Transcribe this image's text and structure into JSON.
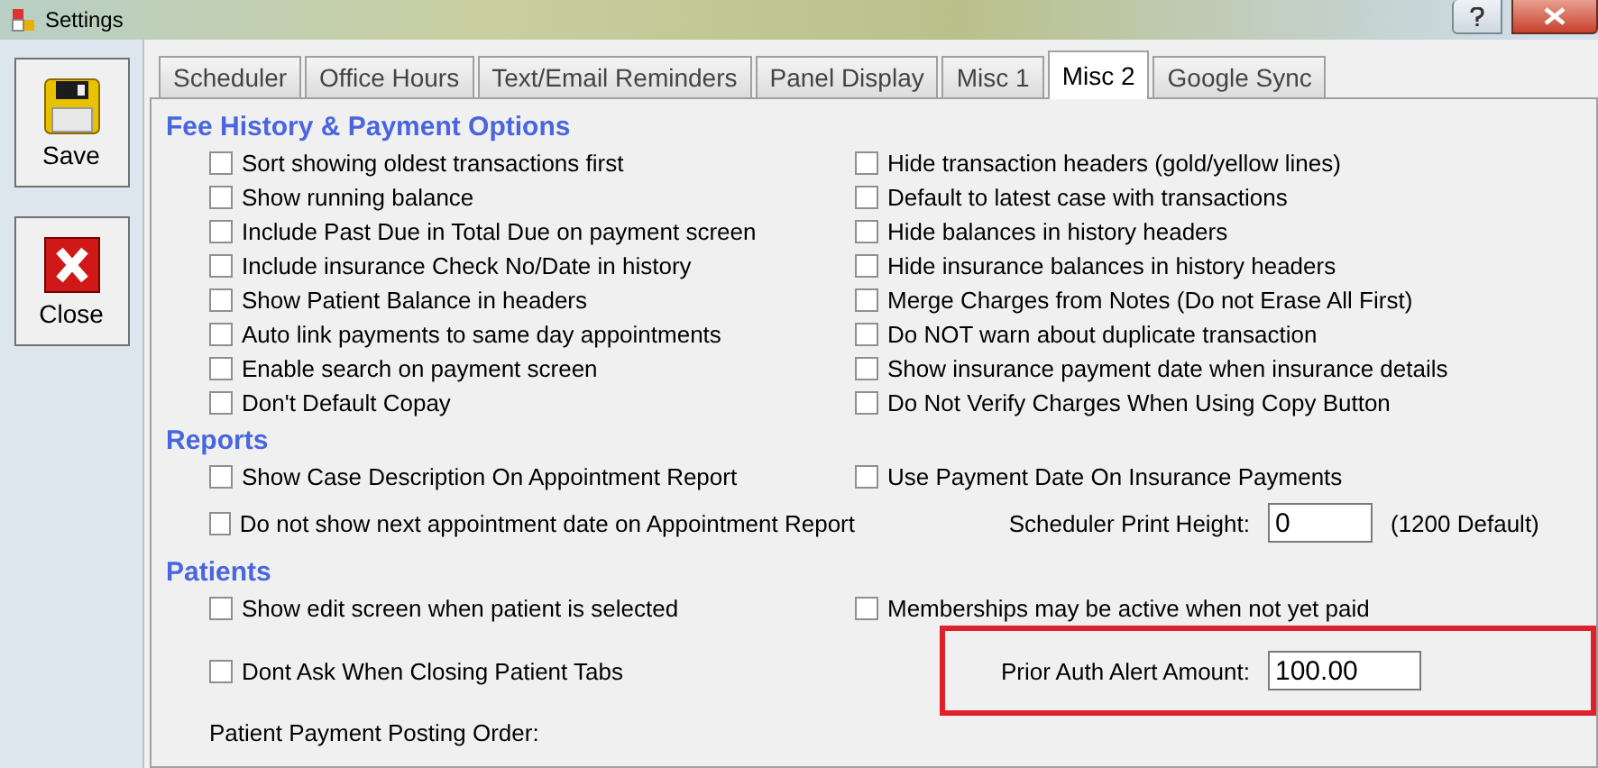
{
  "window": {
    "title": "Settings"
  },
  "sidebar": {
    "buttons": [
      {
        "label": "Save",
        "kind": "save"
      },
      {
        "label": "Close",
        "kind": "close"
      }
    ]
  },
  "tabs": [
    {
      "label": "Scheduler",
      "selected": false
    },
    {
      "label": "Office Hours",
      "selected": false
    },
    {
      "label": "Text/Email Reminders",
      "selected": false
    },
    {
      "label": "Panel Display",
      "selected": false
    },
    {
      "label": "Misc 1",
      "selected": false
    },
    {
      "label": "Misc 2",
      "selected": true
    },
    {
      "label": "Google Sync",
      "selected": false
    }
  ],
  "sections": [
    {
      "heading": "Fee History & Payment Options",
      "rows": [
        [
          {
            "kind": "checkbox",
            "label": "Sort showing oldest transactions first",
            "checked": false
          },
          {
            "kind": "checkbox",
            "label": "Hide transaction headers (gold/yellow lines)",
            "checked": false
          }
        ],
        [
          {
            "kind": "checkbox",
            "label": "Show running balance",
            "checked": false
          },
          {
            "kind": "checkbox",
            "label": "Default to latest case with transactions",
            "checked": false
          }
        ],
        [
          {
            "kind": "checkbox",
            "label": "Include Past Due in Total Due on payment screen",
            "checked": false
          },
          {
            "kind": "checkbox",
            "label": "Hide balances in history headers",
            "checked": false
          }
        ],
        [
          {
            "kind": "checkbox",
            "label": "Include insurance Check No/Date in history",
            "checked": false
          },
          {
            "kind": "checkbox",
            "label": "Hide insurance balances in history headers",
            "checked": false
          }
        ],
        [
          {
            "kind": "checkbox",
            "label": "Show Patient Balance in headers",
            "checked": false
          },
          {
            "kind": "checkbox",
            "label": "Merge Charges from Notes (Do not Erase All First)",
            "checked": false
          }
        ],
        [
          {
            "kind": "checkbox",
            "label": "Auto link payments to same day appointments",
            "checked": false
          },
          {
            "kind": "checkbox",
            "label": "Do NOT warn about duplicate transaction",
            "checked": false
          }
        ],
        [
          {
            "kind": "checkbox",
            "label": "Enable search on payment screen",
            "checked": false
          },
          {
            "kind": "checkbox",
            "label": "Show insurance payment date when insurance details",
            "checked": false
          }
        ],
        [
          {
            "kind": "checkbox",
            "label": "Don't Default Copay",
            "checked": false
          },
          {
            "kind": "checkbox",
            "label": "Do Not Verify Charges When Using Copy Button",
            "checked": false
          }
        ]
      ]
    },
    {
      "heading": "Reports",
      "rows": [
        [
          {
            "kind": "checkbox",
            "label": "Show Case Description On Appointment Report",
            "checked": false
          },
          {
            "kind": "checkbox",
            "label": "Use Payment Date On Insurance Payments",
            "checked": false
          }
        ],
        [
          {
            "kind": "checkbox",
            "label": "Do not show next appointment date on Appointment Report",
            "checked": false
          },
          {
            "kind": "field",
            "label": "Scheduler Print Height:",
            "value": "0",
            "note": "(1200 Default)"
          }
        ]
      ]
    },
    {
      "heading": "Patients",
      "rows": [
        [
          {
            "kind": "checkbox",
            "label": "Show edit screen when patient is selected",
            "checked": false
          },
          {
            "kind": "checkbox",
            "label": "Memberships may be active when not yet paid",
            "checked": false
          }
        ],
        [
          {
            "kind": "checkbox",
            "label": "Dont Ask When Closing Patient Tabs",
            "checked": false
          },
          {
            "kind": "field",
            "label": "Prior Auth Alert Amount:",
            "value": "100.00",
            "highlighted": true
          }
        ]
      ],
      "footer": "Patient Payment Posting Order:"
    }
  ]
}
